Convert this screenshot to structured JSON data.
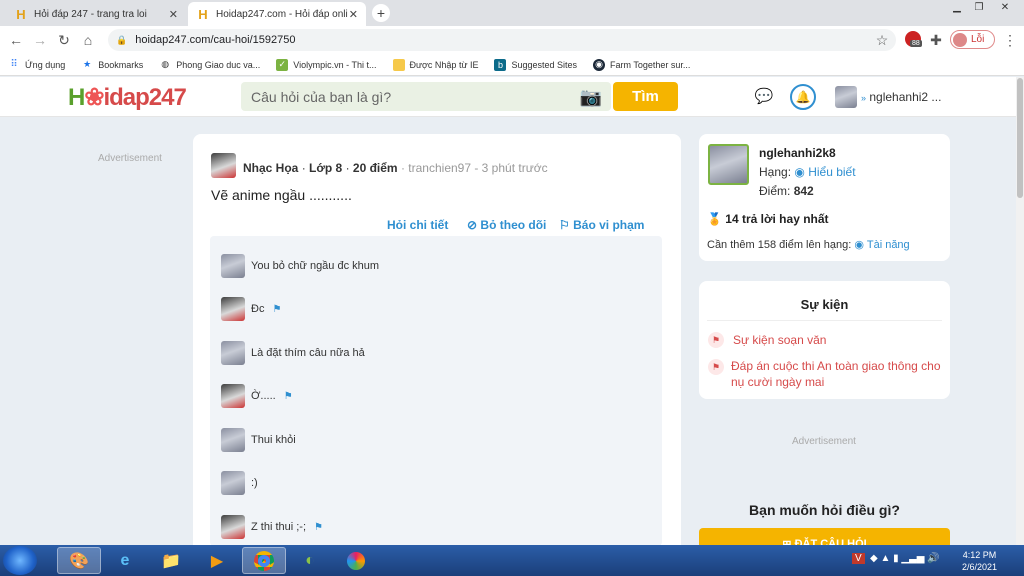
{
  "browser": {
    "tabs": [
      {
        "label": "Hỏi đáp 247 - trang tra loi",
        "active": false
      },
      {
        "label": "Hoidap247.com - Hỏi đáp online",
        "active": true
      }
    ],
    "url": "hoidap247.com/cau-hoi/1592750",
    "profile_label": "Lỗi",
    "ext_badge": "88",
    "bookmarks": [
      "Ứng dụng",
      "Bookmarks",
      "Phong Giao duc va...",
      "Violympic.vn - Thi t...",
      "Được Nhập từ IE",
      "Suggested Sites",
      "Farm Together sur..."
    ]
  },
  "header": {
    "logo": "Hoidap247",
    "search_placeholder": "Câu hỏi của bạn là gì?",
    "search_button": "Tìm",
    "username": "nglehanhi2 ..."
  },
  "left": {
    "advertisement": "Advertisement"
  },
  "question": {
    "author": "Nhạc Họa",
    "grade": "Lớp 8",
    "points": "20 điểm",
    "meta": "tranchien97 - 3 phút trước",
    "text": "Vẽ anime ngầu ...........",
    "actions": {
      "detail": "Hỏi chi tiết",
      "unfollow": "Bỏ theo dõi",
      "report": "Báo vi phạm"
    }
  },
  "comments": [
    {
      "text": "You bỏ chữ ngầu đc khum",
      "flag": false
    },
    {
      "text": "Đc",
      "flag": true
    },
    {
      "text": "Là đặt thím câu nữa hả",
      "flag": false
    },
    {
      "text": "Ờ.....",
      "flag": true
    },
    {
      "text": "Thui khỏi",
      "flag": false
    },
    {
      "text": ":)",
      "flag": false
    },
    {
      "text": "Z thi thui ;-;",
      "flag": true
    }
  ],
  "profile": {
    "name": "nglehanhi2k8",
    "rank_label": "Hạng:",
    "rank_value": "Hiểu biết",
    "points_label": "Điểm:",
    "points_value": "842",
    "best_answers": "14 trả lời hay nhất",
    "next_rank_text": "Cần thêm 158 điểm lên hạng:",
    "next_rank_value": "Tài năng"
  },
  "events": {
    "title": "Sự kiện",
    "items": [
      "Sự kiện soạn văn",
      "Đáp án cuộc thi An toàn giao thông cho nụ cười ngày mai"
    ]
  },
  "right": {
    "advertisement": "Advertisement",
    "ask_title": "Bạn muốn hỏi điều gì?",
    "ask_button": "ĐẶT CÂU HỎI"
  },
  "taskbar": {
    "time": "4:12 PM",
    "date": "2/6/2021"
  },
  "colors": {
    "accent": "#2f8fd0",
    "brand_yellow": "#f5b400",
    "alert_red": "#d64a4a"
  }
}
